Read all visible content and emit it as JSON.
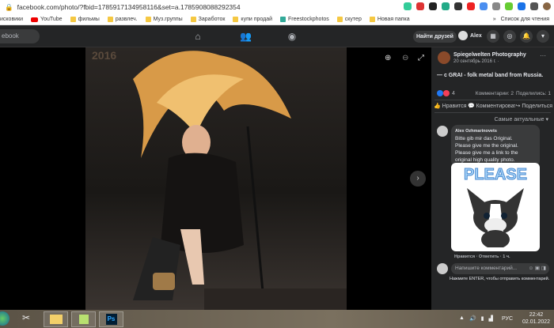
{
  "browser": {
    "url": "facebook.com/photo/?fbid=1785917134958116&set=a.1785908088292354",
    "bookmarks": [
      "исковики",
      "YouTube",
      "фильмы",
      "развлеч.",
      "Муз.группы",
      "Заработок",
      "купи продай",
      "Freestockphotos",
      "скутер",
      "Новая папка"
    ],
    "more": "»",
    "reading_list": "Список для чтения"
  },
  "fb": {
    "search_placeholder": "ebook",
    "find_friends": "Найти друзей",
    "user": "Alex"
  },
  "post": {
    "author": "Spiegelwelten Photography",
    "date": "20 сентябрь 2016 г. ·",
    "text": "— с GRAI - folk metal band from Russia.",
    "reactions": "4",
    "comments": "Комментарии: 2",
    "shares": "Поделились: 1",
    "actions": [
      "Нравится",
      "Комментировать",
      "Поделиться"
    ],
    "sort": "Самые актуальные",
    "photo_text": "2016"
  },
  "comment": {
    "author": "Alex Ozhmarinovets",
    "lines": [
      "Bitte gib mir das Original.",
      "Please give me the original.",
      "Please give me a link to the original high quality photo."
    ],
    "sticker": "PLEASE",
    "meta": "Нравится · Ответить · 1 ч."
  },
  "composer": {
    "placeholder": "Напишите комментарий...",
    "hint": "Нажмите ENTER, чтобы отправить комментарий."
  },
  "taskbar": {
    "lang": "РУС",
    "time": "22:42",
    "date": "02.01.2022"
  }
}
